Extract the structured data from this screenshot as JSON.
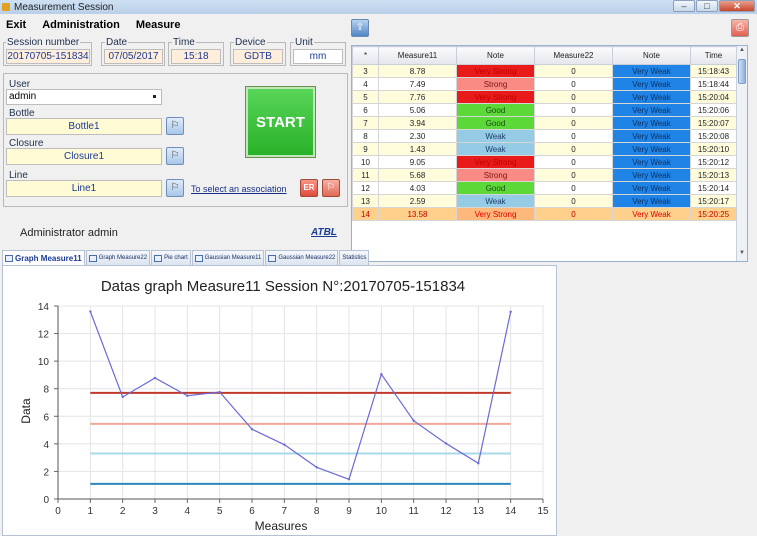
{
  "window": {
    "title": "Measurement Session"
  },
  "menu": {
    "exit": "Exit",
    "administration": "Administration",
    "measure": "Measure"
  },
  "session": {
    "session_number": {
      "label": "Session number",
      "value": "20170705-151834"
    },
    "date": {
      "label": "Date",
      "value": "07/05/2017"
    },
    "time": {
      "label": "Time",
      "value": "15:18"
    },
    "device": {
      "label": "Device",
      "value": "GDTB"
    },
    "unit": {
      "label": "Unit",
      "value": "mm"
    }
  },
  "user": {
    "label": "User",
    "value": "admin"
  },
  "bottle": {
    "label": "Bottle",
    "value": "Bottle1"
  },
  "closure": {
    "label": "Closure",
    "value": "Closure1"
  },
  "line": {
    "label": "Line",
    "value": "Line1"
  },
  "start_label": "START",
  "select_association": "To select an association",
  "er_label": "ER",
  "admin_text": "Administrator admin",
  "atbl_text": "ATBL",
  "table": {
    "headers": [
      "*",
      "Measure11",
      "Note",
      "Measure22",
      "Note",
      "Time"
    ],
    "rows": [
      {
        "n": "3",
        "m11": "8.78",
        "note1": "Very Strong",
        "c1": "vs",
        "m22": "0",
        "note2": "Very Weak",
        "time": "15:18:43"
      },
      {
        "n": "4",
        "m11": "7.49",
        "note1": "Strong",
        "c1": "st",
        "m22": "0",
        "note2": "Very Weak",
        "time": "15:18:44"
      },
      {
        "n": "5",
        "m11": "7.76",
        "note1": "Very Strong",
        "c1": "vs",
        "m22": "0",
        "note2": "Very Weak",
        "time": "15:20:04"
      },
      {
        "n": "6",
        "m11": "5.06",
        "note1": "Good",
        "c1": "gd",
        "m22": "0",
        "note2": "Very Weak",
        "time": "15:20:06"
      },
      {
        "n": "7",
        "m11": "3.94",
        "note1": "Good",
        "c1": "gd",
        "m22": "0",
        "note2": "Very Weak",
        "time": "15:20:07"
      },
      {
        "n": "8",
        "m11": "2.30",
        "note1": "Weak",
        "c1": "wk",
        "m22": "0",
        "note2": "Very Weak",
        "time": "15:20:08"
      },
      {
        "n": "9",
        "m11": "1.43",
        "note1": "Weak",
        "c1": "wk",
        "m22": "0",
        "note2": "Very Weak",
        "time": "15:20:10"
      },
      {
        "n": "10",
        "m11": "9.05",
        "note1": "Very Strong",
        "c1": "vs",
        "m22": "0",
        "note2": "Very Weak",
        "time": "15:20:12"
      },
      {
        "n": "11",
        "m11": "5.68",
        "note1": "Strong",
        "c1": "st",
        "m22": "0",
        "note2": "Very Weak",
        "time": "15:20:13"
      },
      {
        "n": "12",
        "m11": "4.03",
        "note1": "Good",
        "c1": "gd",
        "m22": "0",
        "note2": "Very Weak",
        "time": "15:20:14"
      },
      {
        "n": "13",
        "m11": "2.59",
        "note1": "Weak",
        "c1": "wk",
        "m22": "0",
        "note2": "Very Weak",
        "time": "15:20:17"
      },
      {
        "n": "14",
        "m11": "13.58",
        "note1": "Very Strong",
        "c1": "vs",
        "m22": "0",
        "note2": "Very Weak",
        "time": "15:20:25",
        "highlight": true
      }
    ]
  },
  "tabs": [
    "Graph Measure11",
    "Graph Measure22",
    "Pie chart",
    "Gaussian Measure11",
    "Gaussian Measure22",
    "Statistics"
  ],
  "chart_data": {
    "type": "line",
    "title": "Datas graph Measure11 Session N°:20170705-151834",
    "xlabel": "Measures",
    "ylabel": "Data",
    "x": [
      1,
      2,
      3,
      4,
      5,
      6,
      7,
      8,
      9,
      10,
      11,
      12,
      13,
      14
    ],
    "values": [
      13.6,
      7.4,
      8.78,
      7.49,
      7.76,
      5.06,
      3.94,
      2.3,
      1.43,
      9.05,
      5.68,
      4.03,
      2.59,
      13.58
    ],
    "xlim": [
      0,
      15
    ],
    "ylim": [
      0,
      14
    ],
    "xticks": [
      0,
      1,
      2,
      3,
      4,
      5,
      6,
      7,
      8,
      9,
      10,
      11,
      12,
      13,
      14,
      15
    ],
    "yticks": [
      0,
      2,
      4,
      6,
      8,
      10,
      12,
      14
    ],
    "grid": true,
    "line_color": "#6b6bd6",
    "thresholds": [
      {
        "value": 7.7,
        "color": "#c0392b"
      },
      {
        "value": 5.45,
        "color": "#f0a898"
      },
      {
        "value": 3.3,
        "color": "#a8d8ea"
      },
      {
        "value": 1.1,
        "color": "#2e86c1"
      }
    ]
  }
}
